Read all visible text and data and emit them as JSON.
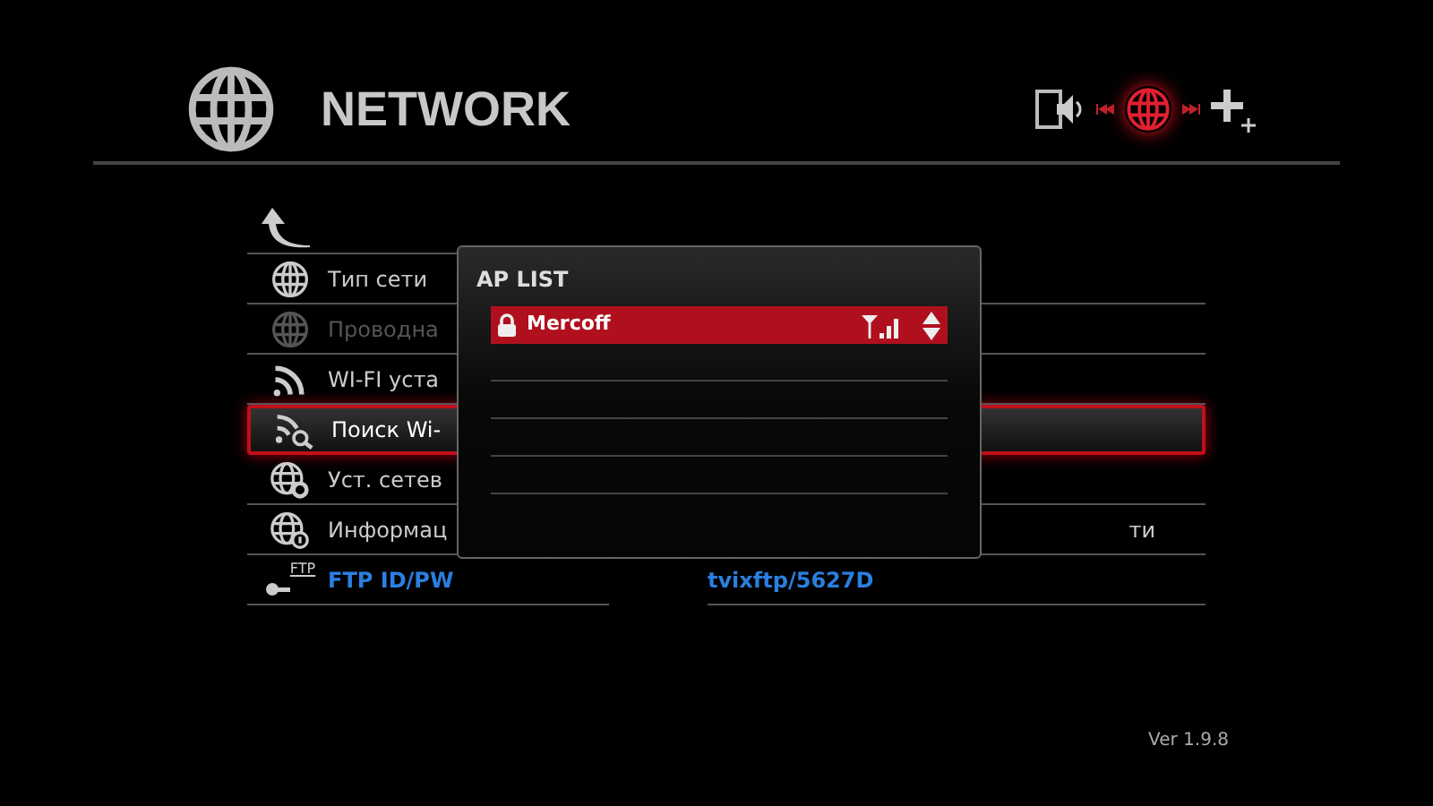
{
  "header": {
    "title": "NETWORK"
  },
  "menu": [
    {
      "kind": "globe",
      "label": "Тип сети",
      "disabled": false,
      "selected": false
    },
    {
      "kind": "globe-cable",
      "label": "Проводна",
      "disabled": true,
      "selected": false
    },
    {
      "kind": "wifi",
      "label": "WI-FI уста",
      "disabled": false,
      "selected": false
    },
    {
      "kind": "wifi-search",
      "label": "Поиск Wi-",
      "disabled": false,
      "selected": true
    },
    {
      "kind": "globe-gear",
      "label": "Уст. сетев",
      "disabled": false,
      "selected": false
    },
    {
      "kind": "globe-info",
      "label": "Информац",
      "value": "ти",
      "disabled": false,
      "selected": false
    },
    {
      "kind": "ftp",
      "icon_text": "FTP",
      "label": "FTP ID/PW",
      "value": "tvixftp/5627D",
      "disabled": false,
      "selected": false
    }
  ],
  "ap_list": {
    "title": "AP LIST",
    "items": [
      {
        "name": "Mercoff",
        "locked": true,
        "selected": true
      }
    ]
  },
  "version": "Ver 1.9.8"
}
